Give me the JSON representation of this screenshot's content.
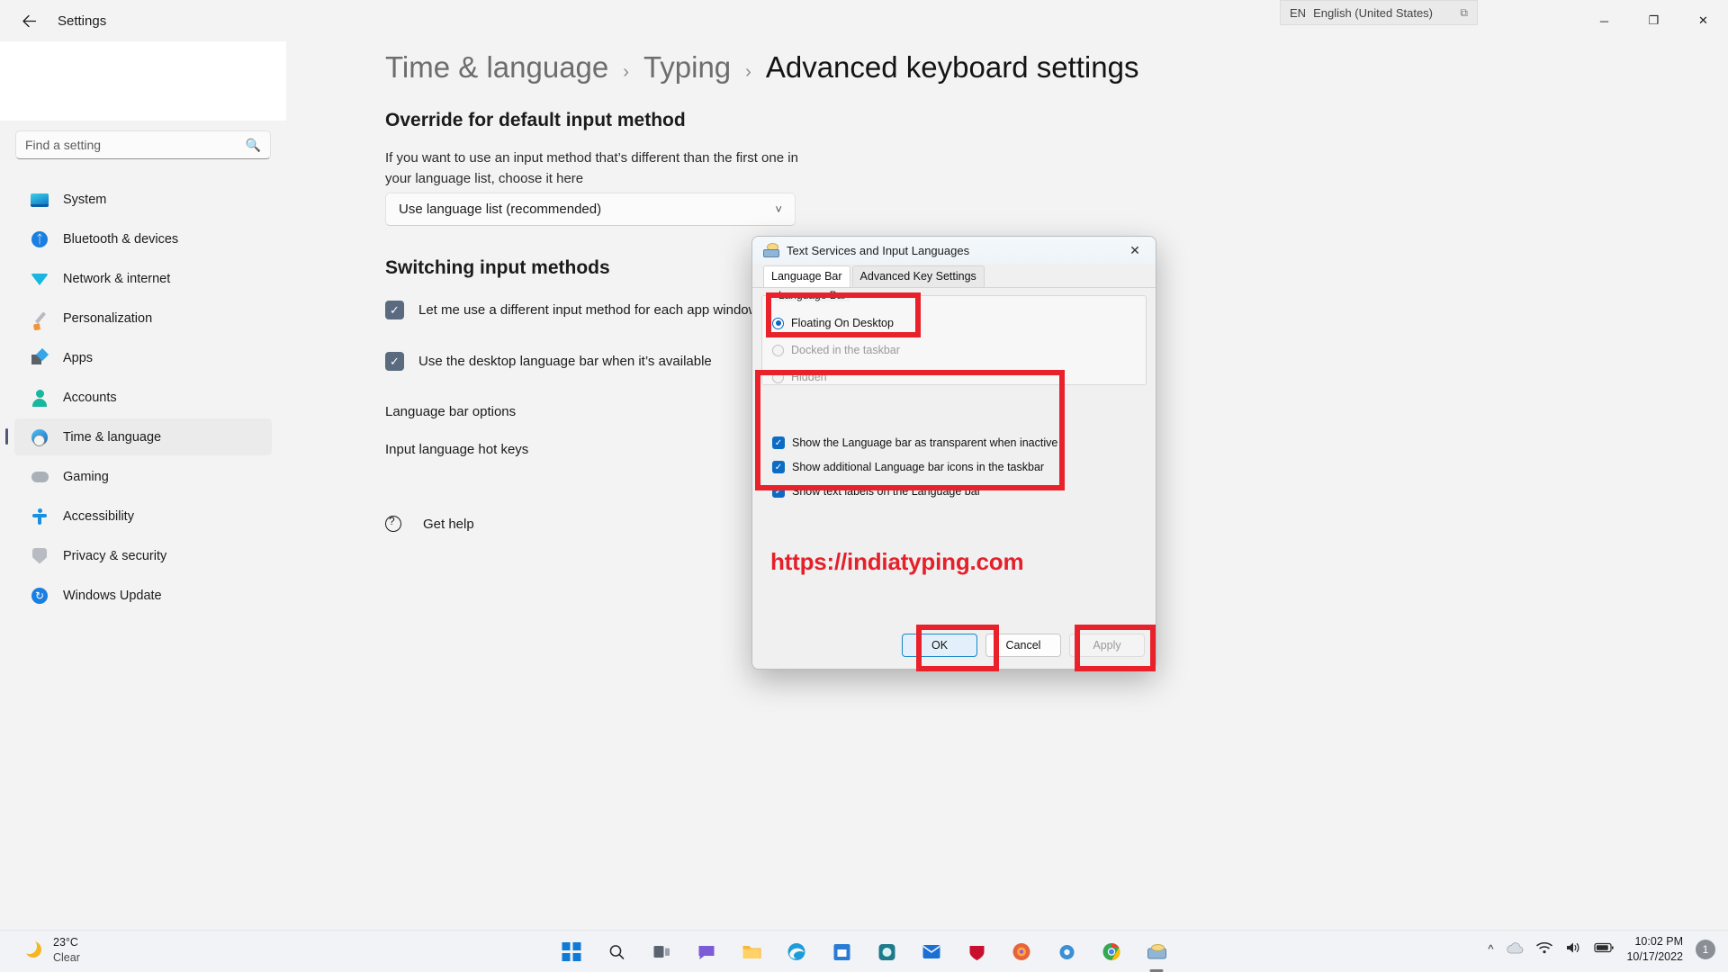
{
  "window": {
    "back_icon": "back-arrow-icon",
    "app_title": "Settings",
    "minimize_label": "─",
    "maximize_label": "❐",
    "close_label": "✕"
  },
  "language_indicator": {
    "code": "EN",
    "name": "English (United States)",
    "restore_icon": "restore-down-icon"
  },
  "search": {
    "placeholder": "Find a setting",
    "value": "",
    "icon": "search-icon"
  },
  "sidebar": {
    "items": [
      {
        "label": "System",
        "icon": "system-icon",
        "active": false
      },
      {
        "label": "Bluetooth & devices",
        "icon": "bluetooth-icon",
        "active": false
      },
      {
        "label": "Network & internet",
        "icon": "network-icon",
        "active": false
      },
      {
        "label": "Personalization",
        "icon": "personalization-icon",
        "active": false
      },
      {
        "label": "Apps",
        "icon": "apps-icon",
        "active": false
      },
      {
        "label": "Accounts",
        "icon": "accounts-icon",
        "active": false
      },
      {
        "label": "Time & language",
        "icon": "time-language-icon",
        "active": true
      },
      {
        "label": "Gaming",
        "icon": "gaming-icon",
        "active": false
      },
      {
        "label": "Accessibility",
        "icon": "accessibility-icon",
        "active": false
      },
      {
        "label": "Privacy & security",
        "icon": "privacy-shield-icon",
        "active": false
      },
      {
        "label": "Windows Update",
        "icon": "windows-update-icon",
        "active": false
      }
    ]
  },
  "breadcrumb": {
    "root": "Time & language",
    "middle": "Typing",
    "current": "Advanced keyboard settings",
    "separator": "›"
  },
  "main": {
    "override_heading": "Override for default input method",
    "override_description": "If you want to use an input method that’s different than the first one in your language list, choose it here",
    "override_dropdown_value": "Use language list (recommended)",
    "override_dropdown_chevron": "chevron-down-icon",
    "switching_heading": "Switching input methods",
    "checkbox_app_window": "Let me use a different input method for each app window",
    "checkbox_app_window_checked": true,
    "checkbox_desktop_bar": "Use the desktop language bar when it’s available",
    "checkbox_desktop_bar_checked": true,
    "link_language_bar_options": "Language bar options",
    "link_input_hot_keys": "Input language hot keys",
    "get_help": "Get help",
    "get_help_icon": "help-question-icon",
    "check_glyph": "✓"
  },
  "dialog": {
    "title": "Text Services and Input Languages",
    "title_icon": "keyboard-language-icon",
    "close_icon": "close-icon",
    "tabs": [
      {
        "label": "Language Bar",
        "active": true
      },
      {
        "label": "Advanced Key Settings",
        "active": false
      }
    ],
    "group_legend": "Language Bar",
    "radios": [
      {
        "label": "Floating On Desktop",
        "checked": true,
        "disabled": false
      },
      {
        "label": "Docked in the taskbar",
        "checked": false,
        "disabled": true
      },
      {
        "label": "Hidden",
        "checked": false,
        "disabled": true
      }
    ],
    "checkboxes": [
      {
        "label": "Show the Language bar as transparent when inactive",
        "checked": true
      },
      {
        "label": "Show additional Language bar icons in the taskbar",
        "checked": true
      },
      {
        "label": "Show text labels on the Language bar",
        "checked": true
      }
    ],
    "check_glyph": "✓",
    "watermark": "https://indiatyping.com",
    "buttons": [
      {
        "label": "OK",
        "style": "primary"
      },
      {
        "label": "Cancel",
        "style": "normal"
      },
      {
        "label": "Apply",
        "style": "disabled"
      }
    ]
  },
  "annotations": {
    "highlight_color": "#e8212a"
  },
  "taskbar": {
    "weather": {
      "temperature": "23°C",
      "condition": "Clear",
      "icon": "moon-icon"
    },
    "apps": [
      {
        "name": "start-button",
        "glyph": ""
      },
      {
        "name": "search-icon",
        "glyph": "⌕"
      },
      {
        "name": "task-view-icon",
        "glyph": "▭"
      },
      {
        "name": "chat-icon",
        "glyph": "὞8"
      },
      {
        "name": "file-explorer-icon",
        "glyph": "Ὄ1"
      },
      {
        "name": "edge-browser-icon",
        "glyph": "◑"
      },
      {
        "name": "microsoft-store-icon",
        "glyph": "ὬD"
      },
      {
        "name": "app-icon-teal",
        "glyph": "◉"
      },
      {
        "name": "mail-icon",
        "glyph": "✉"
      },
      {
        "name": "mcafee-icon",
        "glyph": "M"
      },
      {
        "name": "firefox-icon",
        "glyph": "●"
      },
      {
        "name": "settings-gear-icon",
        "glyph": "⚙"
      },
      {
        "name": "chrome-browser-icon",
        "glyph": "◎"
      },
      {
        "name": "typing-app-icon",
        "glyph": "⌨"
      }
    ],
    "tray": {
      "chevron_icon": "show-hidden-icons-icon",
      "cloud_icon": "onedrive-icon",
      "wifi_icon": "wifi-icon",
      "volume_icon": "volume-icon",
      "battery_icon": "battery-icon",
      "time": "10:02 PM",
      "date": "10/17/2022",
      "notification_count": "1"
    }
  }
}
